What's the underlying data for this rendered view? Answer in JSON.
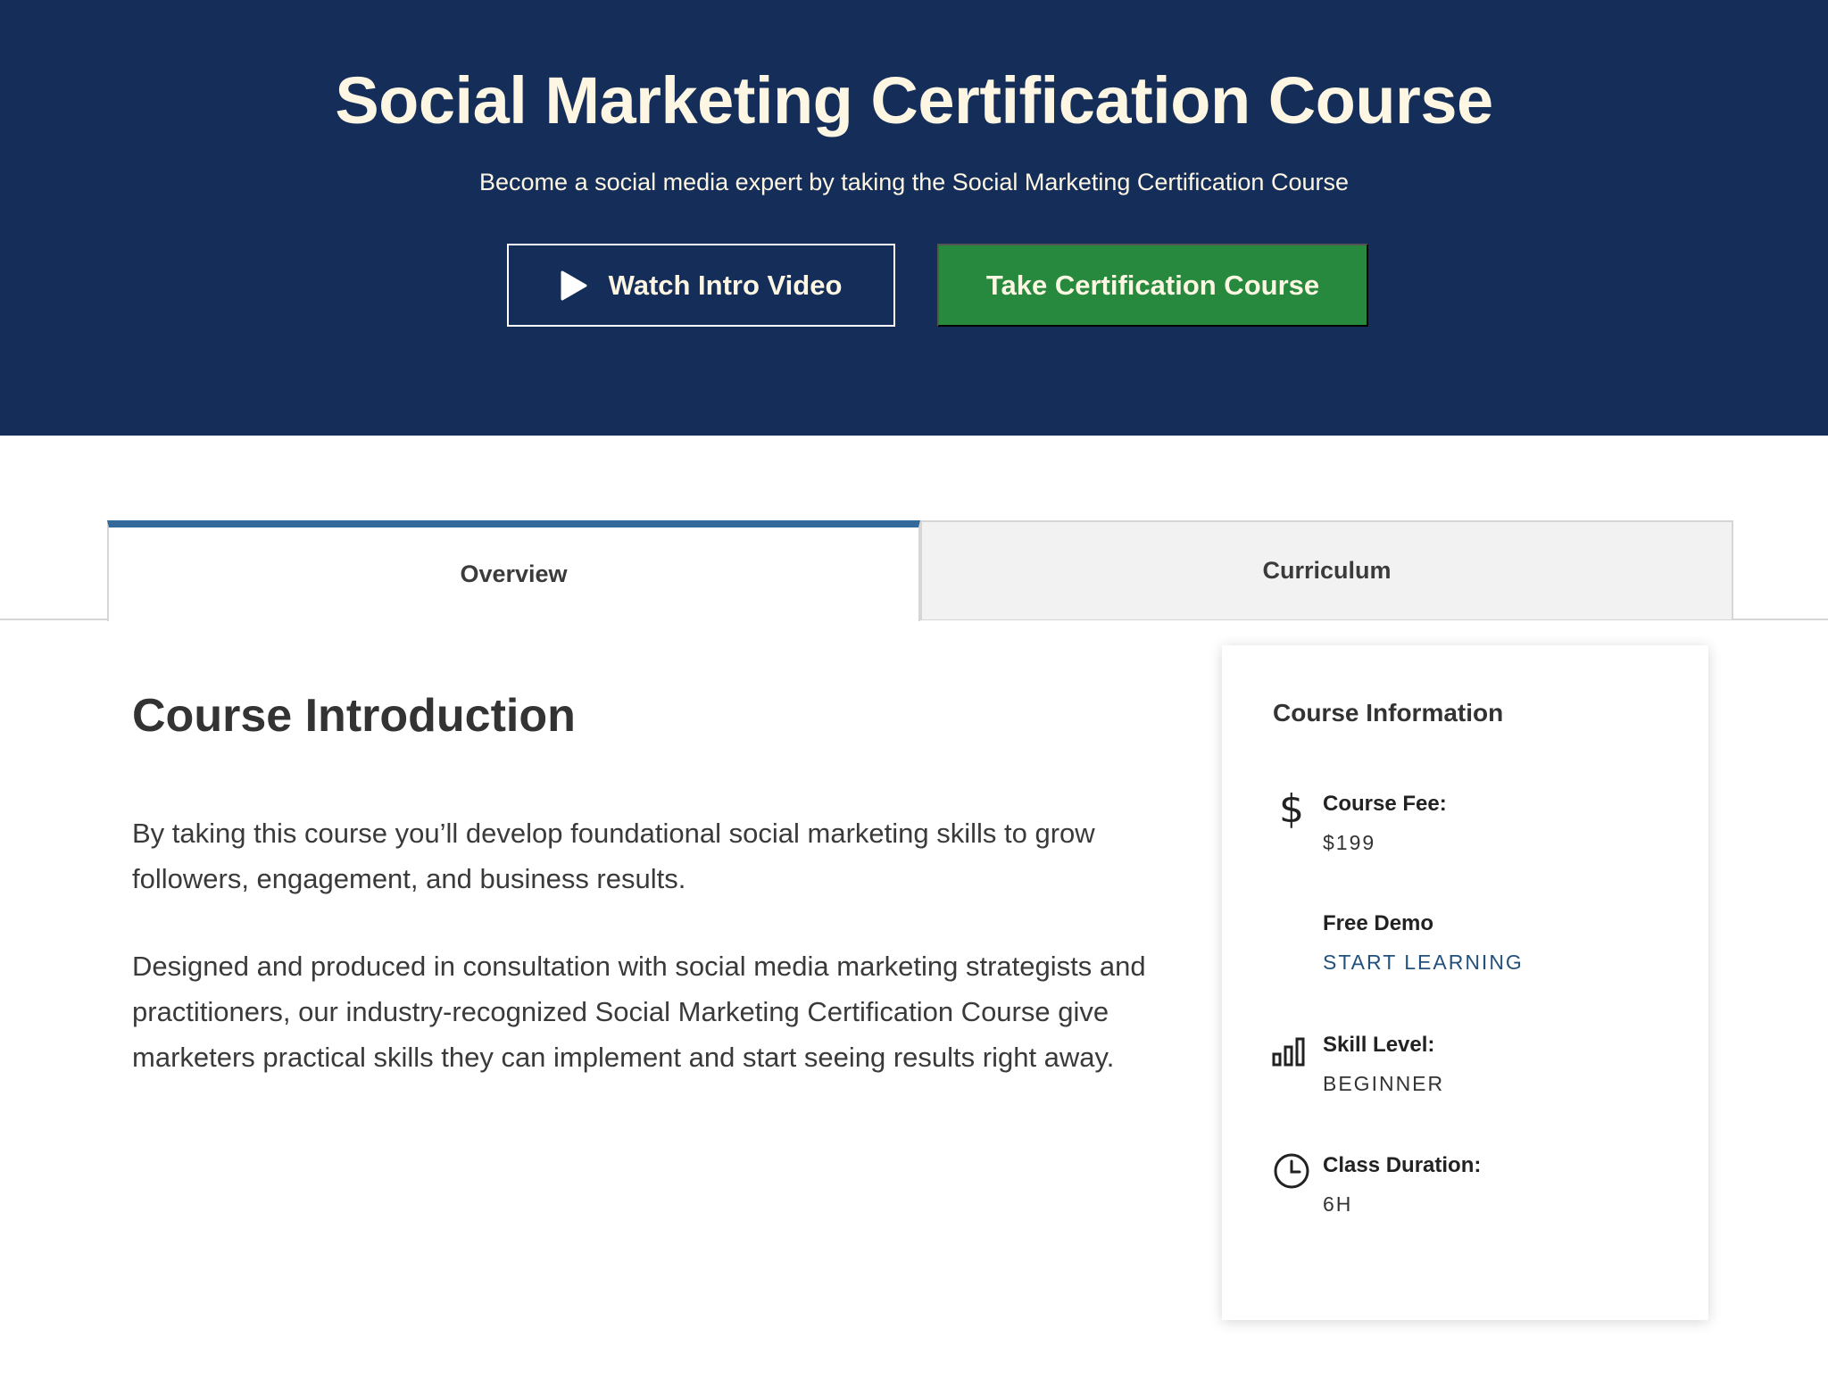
{
  "hero": {
    "title": "Social Marketing Certification Course",
    "subtitle": "Become a social media expert by taking the Social Marketing Certification Course",
    "watch_button": "Watch Intro Video",
    "take_button": "Take Certification Course"
  },
  "tabs": [
    {
      "label": "Overview",
      "active": true
    },
    {
      "label": "Curriculum",
      "active": false
    }
  ],
  "main": {
    "heading": "Course Introduction",
    "paragraphs": [
      "By taking this course you’ll develop foundational social marketing skills to grow followers, engagement, and business results.",
      "Designed and produced in consultation with social media marketing strategists and practitioners, our industry-recognized Social Marketing Certification Course give marketers practical skills they can implement and start seeing results right away."
    ]
  },
  "info": {
    "title": "Course Information",
    "fee_label": "Course Fee:",
    "fee_value": "$199",
    "demo_label": "Free Demo",
    "demo_link": "START LEARNING",
    "skill_label": "Skill Level:",
    "skill_value": "BEGINNER",
    "duration_label": "Class Duration:",
    "duration_value": "6H",
    "icons": {
      "fee": "dollar-icon",
      "skill": "bar-chart-icon",
      "duration": "clock-icon"
    }
  },
  "colors": {
    "hero_bg": "#152e59",
    "primary_button": "#26893e",
    "tab_accent": "#336a9b",
    "link": "#24507c"
  }
}
